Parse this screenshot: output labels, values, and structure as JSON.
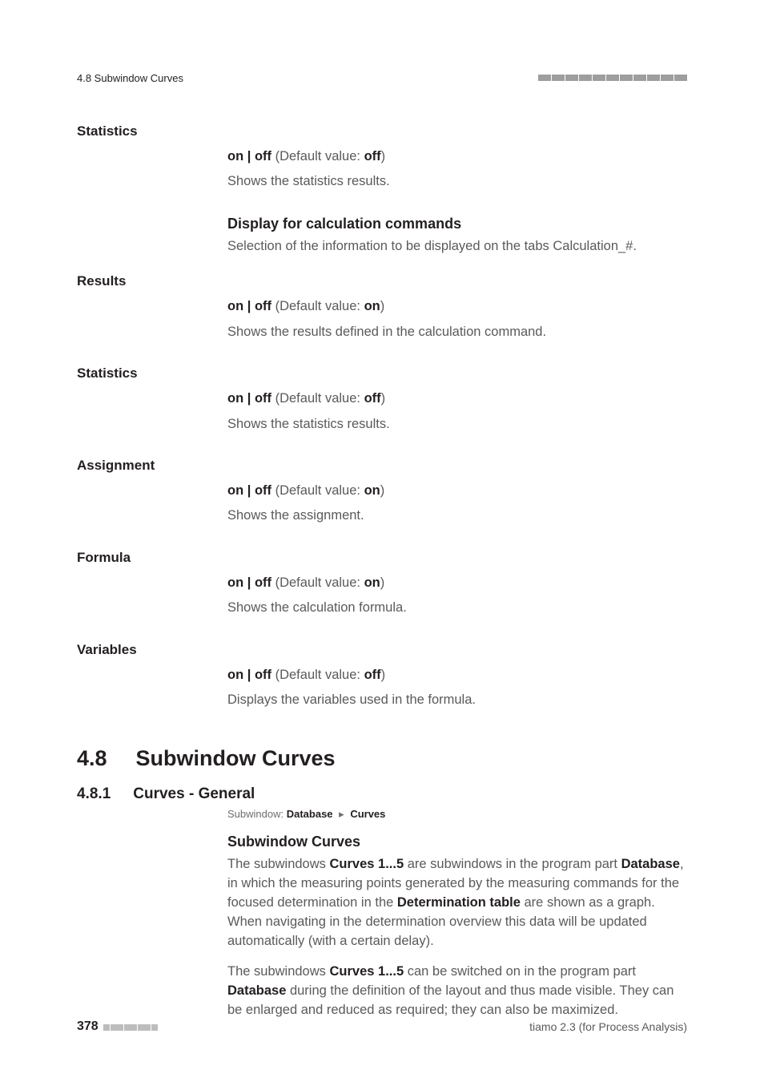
{
  "header": {
    "left": "4.8 Subwindow Curves"
  },
  "defs": {
    "statistics1": {
      "name": "Statistics",
      "onoff_prefix": "on | off",
      "default_label": " (Default value: ",
      "default_value": "off",
      "close_paren": ")",
      "desc": "Shows the statistics results."
    },
    "display_commands": {
      "heading": "Display for calculation commands",
      "desc_a": "Selection of the information to be displayed on the tabs ",
      "desc_b": "Calculation_#",
      "desc_c": "."
    },
    "results": {
      "name": "Results",
      "onoff_prefix": "on | off",
      "default_label": " (Default value: ",
      "default_value": "on",
      "close_paren": ")",
      "desc": "Shows the results defined in the calculation command."
    },
    "statistics2": {
      "name": "Statistics",
      "onoff_prefix": "on | off",
      "default_label": " (Default value: ",
      "default_value": "off",
      "close_paren": ")",
      "desc": "Shows the statistics results."
    },
    "assignment": {
      "name": "Assignment",
      "onoff_prefix": "on | off",
      "default_label": " (Default value: ",
      "default_value": "on",
      "close_paren": ")",
      "desc": "Shows the assignment."
    },
    "formula": {
      "name": "Formula",
      "onoff_prefix": "on | off",
      "default_label": " (Default value: ",
      "default_value": "on",
      "close_paren": ")",
      "desc": "Shows the calculation formula."
    },
    "variables": {
      "name": "Variables",
      "onoff_prefix": "on | off",
      "default_label": " (Default value: ",
      "default_value": "off",
      "close_paren": ")",
      "desc": "Displays the variables used in the formula."
    }
  },
  "section": {
    "num": "4.8",
    "title": "Subwindow Curves",
    "sub_num": "4.8.1",
    "sub_title": "Curves - General",
    "crumb_prefix": "Subwindow: ",
    "crumb_a": "Database",
    "crumb_sep": "▸",
    "crumb_b": "Curves",
    "subhead": "Subwindow Curves",
    "para1_a": "The subwindows ",
    "para1_b": "Curves 1...5",
    "para1_c": " are subwindows in the program part ",
    "para1_d": "Database",
    "para1_e": ", in which the measuring points generated by the measuring commands for the focused determination in the ",
    "para1_f": "Determination table",
    "para1_g": " are shown as a graph. When navigating in the determination overview this data will be updated automatically (with a certain delay).",
    "para2_a": "The subwindows ",
    "para2_b": "Curves 1...5",
    "para2_c": " can be switched on in the program part ",
    "para2_d": "Database",
    "para2_e": " during the definition of the layout and thus made visible. They can be enlarged and reduced as required; they can also be maximized."
  },
  "footer": {
    "page": "378",
    "right": "tiamo 2.3 (for Process Analysis)"
  }
}
